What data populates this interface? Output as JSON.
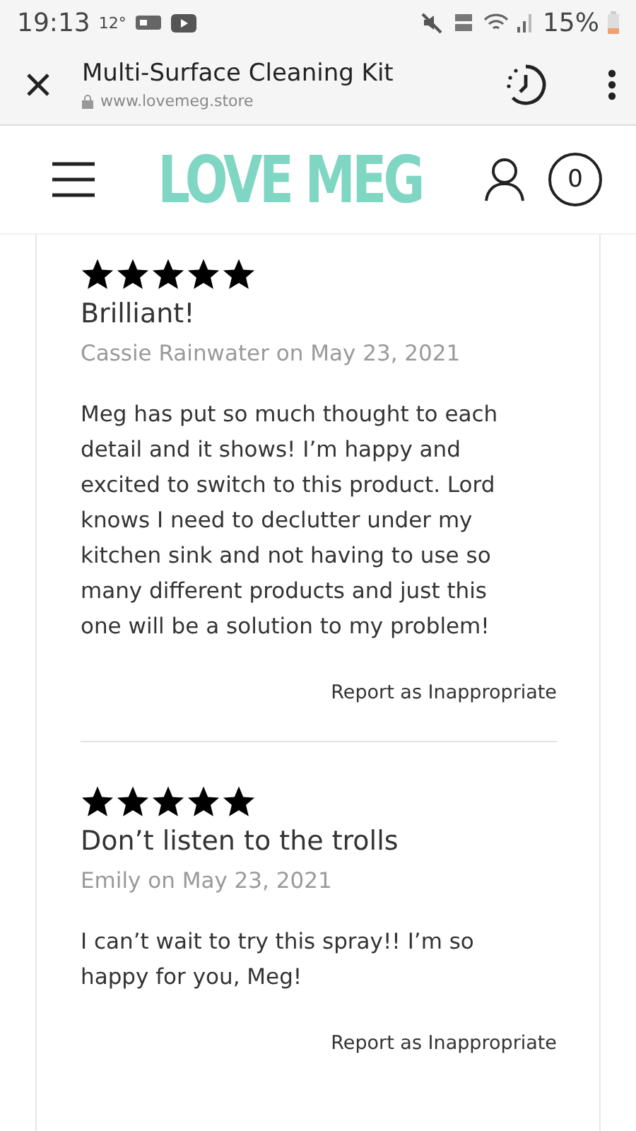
{
  "status_bar": {
    "time": "19:13",
    "temperature": "12°",
    "battery_text": "15%"
  },
  "browser": {
    "title": "Multi-Surface Cleaning Kit",
    "url": "www.lovemeg.store"
  },
  "header": {
    "logo": "LOVE MEG",
    "cart_count": "0"
  },
  "reviews": [
    {
      "stars": 5,
      "title": "Brilliant!",
      "byline": "Cassie Rainwater on May 23, 2021",
      "body": "Meg has put so much thought to each detail and it shows! I’m happy and excited to switch to this product. Lord knows I need to declutter under my kitchen sink and not having to use so many different products and just this one will be a solution to my problem!",
      "report": "Report as Inappropriate"
    },
    {
      "stars": 5,
      "title": "Don’t listen to the trolls",
      "byline": "Emily on May 23, 2021",
      "body": "I can’t wait to try this spray!! I’m so happy for you, Meg!",
      "report": "Report as Inappropriate"
    }
  ]
}
